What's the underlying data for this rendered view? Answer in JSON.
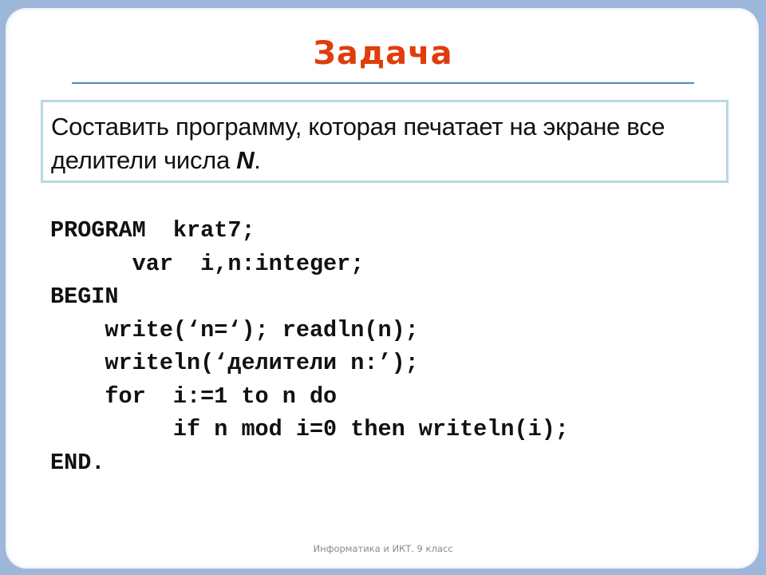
{
  "slide": {
    "title": "Задача",
    "task": {
      "text_before": "Составить программу, которая печатает на экране все делители числа ",
      "emphasis": "N",
      "text_after": "."
    },
    "code_lines": [
      "PROGRAM  krat7;",
      "      var  i,n:integer;",
      "BEGIN",
      "    write(‘n=‘); readln(n);",
      "    writeln(‘делители n:’);",
      "    for  i:=1 to n do",
      "         if n mod i=0 then writeln(i);",
      "END."
    ],
    "footer": "Информатика и ИКТ. 9 класс"
  },
  "colors": {
    "background": "#9db7da",
    "title": "#e03c0c",
    "divider": "#5a86bf",
    "task_border": "#b7d8e2",
    "footer_text": "#8a8a8a"
  }
}
